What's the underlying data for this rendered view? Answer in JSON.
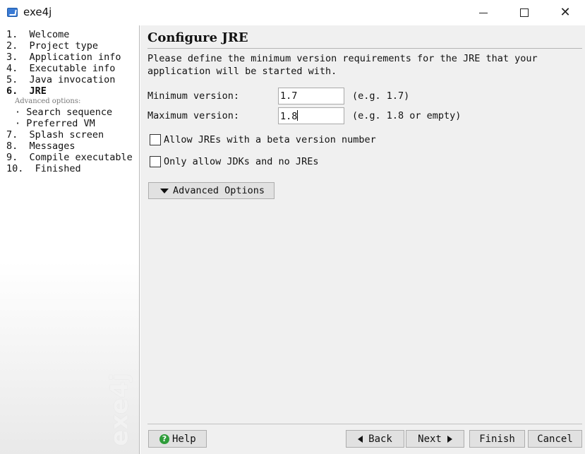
{
  "window": {
    "title": "exe4j",
    "icon": "exe4j-app-icon",
    "controls": [
      "minimize",
      "maximize",
      "close"
    ],
    "close_glyph": "✕"
  },
  "sidebar": {
    "items": [
      {
        "label": "1.  Welcome"
      },
      {
        "label": "2.  Project type"
      },
      {
        "label": "3.  Application info"
      },
      {
        "label": "4.  Executable info"
      },
      {
        "label": "5.  Java invocation"
      },
      {
        "label": "6.  JRE",
        "active": true
      }
    ],
    "advanced_label": "Advanced options:",
    "sub_items": [
      {
        "label": "· Search sequence"
      },
      {
        "label": "· Preferred VM"
      }
    ],
    "items_after": [
      {
        "label": "7.  Splash screen"
      },
      {
        "label": "8.  Messages"
      },
      {
        "label": "9.  Compile executable"
      },
      {
        "label": "10.  Finished"
      }
    ],
    "watermark": "exe4j"
  },
  "main": {
    "title": "Configure JRE",
    "description": "Please define the minimum version requirements for the JRE that your application will be started with.",
    "min_version": {
      "label": "Minimum version:",
      "value": "1.7",
      "hint": "(e.g. 1.7)"
    },
    "max_version": {
      "label": "Maximum version:",
      "value": "1.8",
      "hint": "(e.g. 1.8 or empty)"
    },
    "checkbox_beta": {
      "label": "Allow JREs with a beta version number",
      "checked": false
    },
    "checkbox_jdk": {
      "label": "Only allow JDKs and no JREs",
      "checked": false
    },
    "advanced_button": "Advanced Options"
  },
  "footer": {
    "help": "Help",
    "help_icon": "?",
    "back": "Back",
    "next": "Next",
    "finish": "Finish",
    "cancel": "Cancel"
  }
}
